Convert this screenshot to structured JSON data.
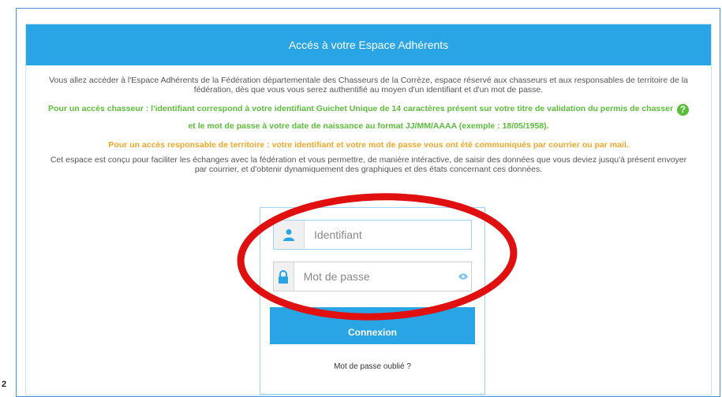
{
  "page_marker": "2",
  "panel": {
    "title": "Accés à votre Espace Adhérents"
  },
  "intro": {
    "line1": "Vous allez accéder à l'Espace Adhérents de la Fédération départementale des Chasseurs de la Corrèze, espace réservé aux chasseurs et aux responsables de territoire de la fédération, dès que vous vous serez authentifié au moyen d'un identifiant et d'un mot de passe.",
    "hunter_part1": "Pour un accès chasseur : l'identifiant correspond à votre identifiant Guichet Unique de 14 caractères présent sur votre titre de validation du permis de chasser",
    "hunter_part2": "et le mot de passe à votre date de naissance au format JJ/MM/AAAA (exemple : 18/05/1958).",
    "territory": "Pour un accès responsable de territoire : votre identifiant et votre mot de passe vous ont été communiqués par courrier ou par mail.",
    "purpose": "Cet espace est conçu pour faciliter les échanges avec la fédération et vous permettre, de manière intéractive, de saisir des données que vous deviez jusqu'à présent envoyer par courrier, et d'obtenir dynamiquement des graphiques et des états concernant ces données."
  },
  "login": {
    "identifier_placeholder": "Identifiant",
    "password_placeholder": "Mot de passe",
    "submit_label": "Connexion",
    "forgot_link": "Mot de passe oublié ?"
  },
  "icons": {
    "help": "question-circle-icon",
    "user": "user-icon",
    "lock": "lock-icon",
    "eye": "eye-icon"
  },
  "colors": {
    "accent_blue": "#29a5e6",
    "hunter_green": "#5bbd3a",
    "territory_orange": "#f2a72a",
    "annotation_red": "#e01010"
  }
}
